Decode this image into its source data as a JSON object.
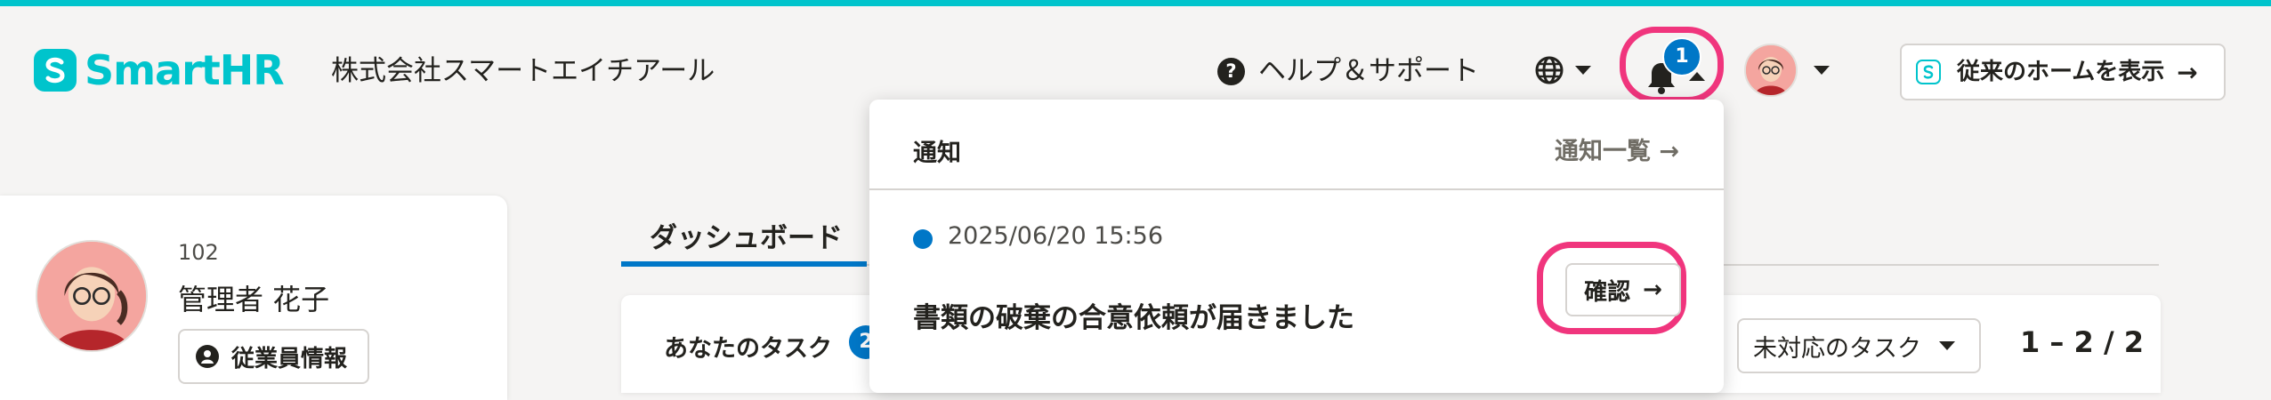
{
  "header": {
    "logo_text": "SmartHR",
    "company_name": "株式会社スマートエイチアール",
    "help_icon_glyph": "?",
    "help_label": "ヘルプ＆サポート",
    "notification_count": "1",
    "home_button_label": "従来のホームを表示",
    "arrow_glyph": "→"
  },
  "notifications": {
    "title": "通知",
    "view_all_label": "通知一覧 →",
    "items": [
      {
        "date": "2025/06/20 15:56",
        "message": "書類の破棄の合意依頼が届きました",
        "action_label": "確認",
        "action_arrow": "→"
      }
    ]
  },
  "profile": {
    "employee_number": "102",
    "name": "管理者 花子",
    "info_button_label": "従業員情報"
  },
  "dashboard": {
    "tab_label": "ダッシュボード",
    "task_title": "あなたのタスク",
    "task_count": "2",
    "filter_selected": "未対応のタスク",
    "pager": "1 – 2 / 2"
  },
  "colors": {
    "brand": "#00c4cc",
    "accent_blue": "#0077c7",
    "highlight": "#f0357d"
  },
  "icons": [
    "smarthr-logo-icon",
    "help-icon",
    "globe-icon",
    "bell-icon",
    "caret-down-icon",
    "caret-up-icon",
    "person-icon",
    "arrow-right-icon"
  ]
}
